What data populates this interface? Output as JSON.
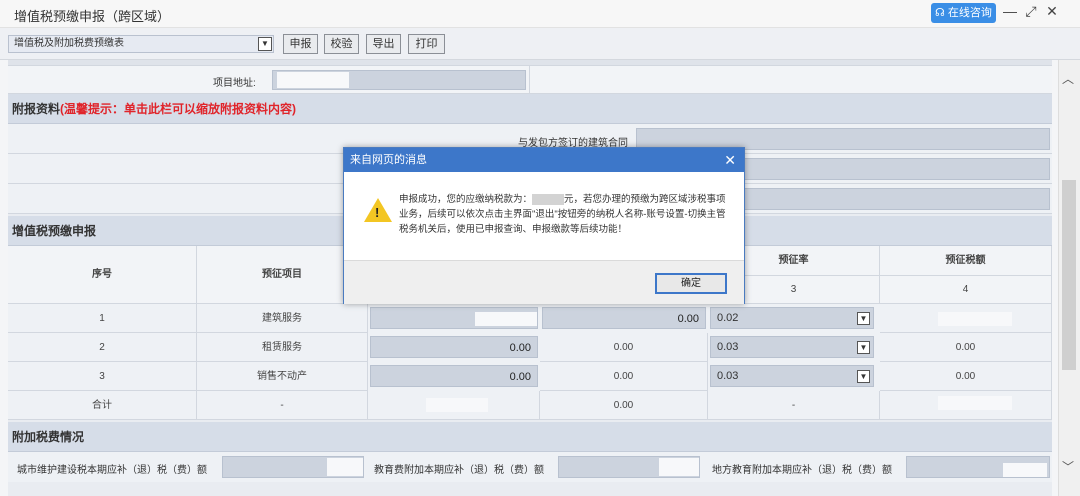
{
  "window": {
    "title": "增值税预缴申报（跨区域）",
    "consult_label": "在线咨询",
    "icons": [
      "minimize-icon",
      "maximize-icon",
      "close-icon"
    ]
  },
  "toolbar": {
    "form_select": "增值税及附加税费预缴表",
    "buttons": [
      "申报",
      "校验",
      "导出",
      "打印"
    ]
  },
  "project": {
    "address_label": "项目地址:"
  },
  "attachments": {
    "heading": "附报资料",
    "tip": "(温馨提示：单击此栏可以缩放附报资料内容)",
    "contract_label": "与发包方签订的建筑合同"
  },
  "vat": {
    "heading": "增值税预缴申报",
    "col_seq": "序号",
    "col_item": "预征项目",
    "col_rate": "预征率",
    "col_tax": "预征税额",
    "col_rate_idx": "3",
    "col_tax_idx": "4",
    "rows": [
      {
        "seq": "1",
        "item": "建筑服务",
        "c2": "0.00",
        "rate": "0.02"
      },
      {
        "seq": "2",
        "item": "租赁服务",
        "c1": "0.00",
        "c2": "0.00",
        "rate": "0.03",
        "tax": "0.00"
      },
      {
        "seq": "3",
        "item": "销售不动产",
        "c1": "0.00",
        "c2": "0.00",
        "rate": "0.03",
        "tax": "0.00"
      }
    ],
    "total": {
      "label": "合计",
      "item": "-",
      "c2": "0.00",
      "rate": "-"
    }
  },
  "surtax": {
    "heading": "附加税费情况",
    "city_label": "城市维护建设税本期应补（退）税（费）额",
    "edu_label": "教育费附加本期应补（退）税（费）额",
    "local_edu_label": "地方教育附加本期应补（退）税（费）额"
  },
  "dialog": {
    "title": "来自网页的消息",
    "msg_part1": "申报成功，您的应缴纳税款为：",
    "msg_part2": "元，若您办理的预缴为跨区域涉税事项业务，后续可以依次点击主界面\"退出\"按钮旁的纳税人名称-账号设置-切换主管税务机关后，使用已申报查询、申报缴款等后续功能！",
    "ok_label": "确定"
  }
}
